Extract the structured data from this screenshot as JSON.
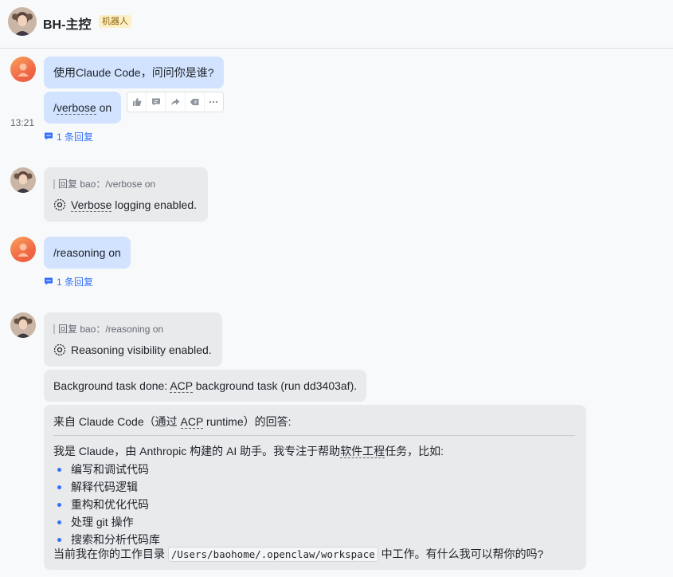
{
  "header": {
    "title": "BH-主控",
    "badge": "机器人"
  },
  "thread": {
    "m1": {
      "text": "使用Claude Code，问问你是谁?"
    },
    "m2": {
      "prefix": "/",
      "keyword": "verbose",
      "suffix": " on",
      "time": "13:21"
    },
    "reply_link1": "1 条回复",
    "r1": {
      "quote": "回复 bao：/verbose on",
      "keyword": "Verbose",
      "rest": " logging enabled."
    },
    "m3": {
      "text": "/reasoning on"
    },
    "reply_link2": "1 条回复",
    "r2": {
      "quote": "回复 bao：/reasoning on",
      "text": "Reasoning visibility enabled."
    },
    "bg": {
      "pre": "Background task done: ",
      "kw": "ACP",
      "post": " background task (run dd3403af)."
    },
    "card": {
      "title_pre": "来自 Claude Code（通过 ",
      "title_kw": "ACP",
      "title_post": " runtime）的回答:",
      "intro_pre": "我是 Claude，由 Anthropic 构建的 AI 助手。我专注于帮助",
      "intro_kw": "软件工程",
      "intro_post": "任务，比如:",
      "items": [
        "编写和调试代码",
        "解释代码逻辑",
        "重构和优化代码",
        "处理 git 操作",
        "搜索和分析代码库"
      ],
      "outro_pre": "当前我在你的工作目录 ",
      "outro_code": "/Users/baohome/.openclaw/workspace",
      "outro_post": " 中工作。有什么我可以帮你的吗?"
    }
  },
  "toolbar": {
    "icons": [
      "thumbs-up-icon",
      "comment-icon",
      "forward-icon",
      "quote-reply-icon",
      "more-icon"
    ]
  },
  "colors": {
    "accent": "#3370ff",
    "user_bubble": "#d1e3ff",
    "bot_bubble": "#e9eaec"
  }
}
